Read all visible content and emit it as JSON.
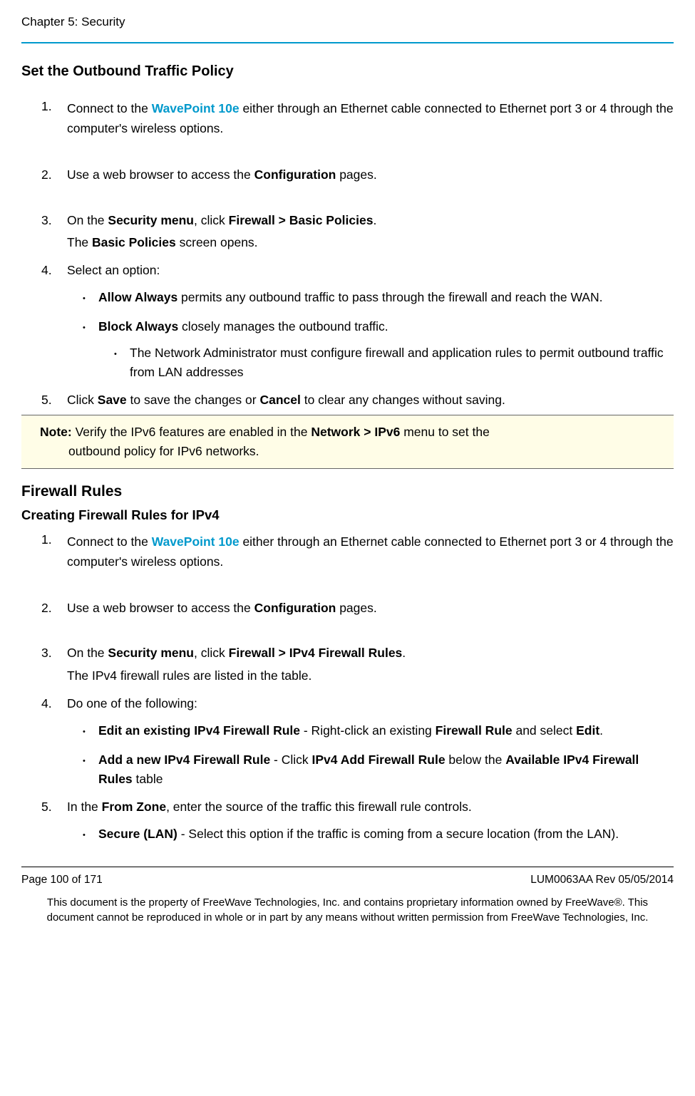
{
  "header": {
    "chapter": "Chapter 5: Security"
  },
  "section1": {
    "title": "Set the Outbound Traffic Policy",
    "steps": {
      "s1_pre": "Connect to the ",
      "s1_link": "WavePoint 10e",
      "s1_post": " either through an Ethernet cable connected to Ethernet port 3 or 4 through the computer's wireless options.",
      "s2_pre": "Use a web browser to access the ",
      "s2_bold": "Configuration",
      "s2_post": " pages.",
      "s3_pre": "On the ",
      "s3_b1": "Security menu",
      "s3_mid": ", click ",
      "s3_b2": "Firewall > Basic Policies",
      "s3_end": ".",
      "s3_line2_pre": "The ",
      "s3_line2_bold": "Basic Policies",
      "s3_line2_post": " screen opens.",
      "s4": "Select an option:",
      "s4_bullet1_bold": "Allow Always",
      "s4_bullet1_rest": " permits any outbound traffic to pass through the firewall and reach the WAN.",
      "s4_bullet2_bold": " Block Always",
      "s4_bullet2_rest": " closely manages the outbound traffic.",
      "s4_subbullet": "The Network Administrator must configure firewall and application rules to permit outbound traffic from LAN addresses",
      "s5_pre": "Click ",
      "s5_b1": "Save",
      "s5_mid": " to save the changes or ",
      "s5_b2": "Cancel",
      "s5_post": " to clear any changes without saving."
    },
    "note": {
      "label": "Note: ",
      "line1_pre": "Verify the IPv6 features are enabled in the ",
      "line1_bold": "Network > IPv6",
      "line1_post": " menu to set the",
      "line2": "outbound policy for IPv6 networks."
    }
  },
  "section2": {
    "title": "Firewall Rules",
    "subtitle": "Creating Firewall Rules for IPv4",
    "steps": {
      "s1_pre": "Connect to the ",
      "s1_link": "WavePoint 10e",
      "s1_post": " either through an Ethernet cable connected to Ethernet port 3 or 4 through the computer's wireless options.",
      "s2_pre": "Use a web browser to access the ",
      "s2_bold": "Configuration",
      "s2_post": " pages.",
      "s3_pre": "On the ",
      "s3_b1": "Security menu",
      "s3_mid": ", click  ",
      "s3_b2": "Firewall > IPv4 Firewall Rules",
      "s3_end": ".",
      "s3_line2": "The IPv4 firewall rules are listed in the table.",
      "s4": "Do one of the following:",
      "s4_b1_bold": "Edit an existing IPv4 Firewall Rule",
      "s4_b1_mid": " - Right-click an existing ",
      "s4_b1_bold2": "Firewall Rule",
      "s4_b1_mid2": " and select ",
      "s4_b1_bold3": "Edit",
      "s4_b1_end": ".",
      "s4_b2_bold": "Add a new IPv4 Firewall Rule",
      "s4_b2_mid": " - Click ",
      "s4_b2_bold2": "IPv4 Add Firewall Rule",
      "s4_b2_mid2": " below the ",
      "s4_b2_bold3": "Available IPv4 Firewall Rules",
      "s4_b2_end": " table",
      "s5_pre": "In the ",
      "s5_bold": "From Zone",
      "s5_post": ", enter the source of the traffic this firewall rule controls.",
      "s5_b1_bold": "Secure (LAN)",
      "s5_b1_rest": " - Select this option if the traffic is coming from a secure location (from the LAN)."
    }
  },
  "footer": {
    "page": "Page 100 of 171",
    "doc": "LUM0063AA Rev 05/05/2014",
    "disclaimer": "This document is the property of FreeWave Technologies, Inc. and contains proprietary information owned by FreeWave®. This document cannot be reproduced in whole or in part by any means without written permission from FreeWave Technologies, Inc."
  }
}
